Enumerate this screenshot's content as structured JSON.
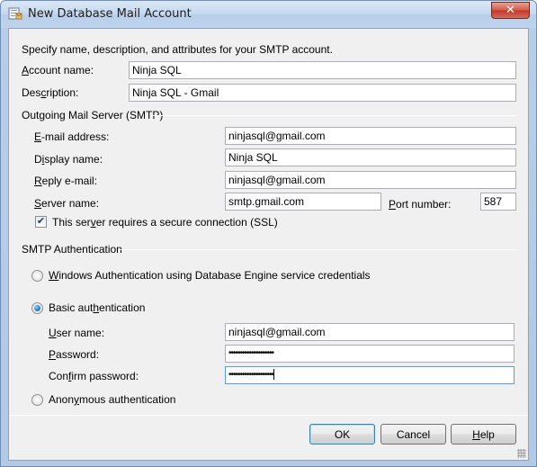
{
  "window": {
    "title": "New Database Mail Account",
    "close_glyph": "✕"
  },
  "intro": "Specify name, description, and attributes for your SMTP account.",
  "account": {
    "name_label_pre": "",
    "name_label_ul": "A",
    "name_label_post": "ccount name:",
    "name_value": "Ninja SQL",
    "desc_label_pre": "Des",
    "desc_label_ul": "c",
    "desc_label_post": "ription:",
    "desc_value": "Ninja SQL - Gmail"
  },
  "smtp_server": {
    "section_title": "Outgoing Mail Server (SMTP)",
    "email_label_pre": "",
    "email_label_ul": "E",
    "email_label_post": "-mail address:",
    "email_value": "ninjasql@gmail.com",
    "display_label_pre": "D",
    "display_label_ul": "i",
    "display_label_post": "splay name:",
    "display_value": "Ninja SQL",
    "reply_label_pre": "",
    "reply_label_ul": "R",
    "reply_label_post": "eply e-mail:",
    "reply_value": "ninjasql@gmail.com",
    "server_label_pre": "",
    "server_label_ul": "S",
    "server_label_post": "erver name:",
    "server_value": "smtp.gmail.com",
    "port_label_pre": "",
    "port_label_ul": "P",
    "port_label_post": "ort number:",
    "port_value": "587",
    "ssl_checked_glyph": "✔",
    "ssl_label_pre": "This ser",
    "ssl_label_ul": "v",
    "ssl_label_post": "er requires a secure connection (SSL)"
  },
  "smtp_auth": {
    "section_title": "SMTP Authentication",
    "windows_label_pre": "",
    "windows_label_ul": "W",
    "windows_label_post": "indows Authentication using Database Engine service credentials",
    "basic_label_pre": "Basic aut",
    "basic_label_ul": "h",
    "basic_label_post": "entication",
    "selected": "basic",
    "username_label_pre": "",
    "username_label_ul": "U",
    "username_label_post": "ser name:",
    "username_value": "ninjasql@gmail.com",
    "password_label_pre": "",
    "password_label_ul": "P",
    "password_label_post": "assword:",
    "password_value": "••••••••••••••••••••",
    "confirm_label_pre": "Con",
    "confirm_label_ul": "f",
    "confirm_label_post": "irm password:",
    "confirm_value": "••••••••••••••••••••",
    "anonymous_label_pre": "Anon",
    "anonymous_label_ul": "y",
    "anonymous_label_post": "mous authentication"
  },
  "buttons": {
    "ok": "OK",
    "cancel": "Cancel",
    "help_ul": "H",
    "help_post": "elp"
  }
}
